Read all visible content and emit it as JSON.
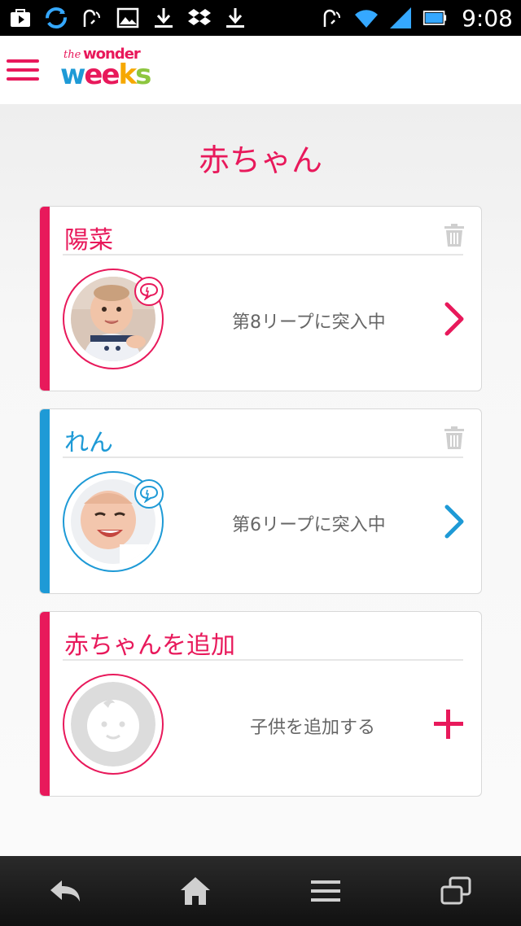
{
  "status_bar": {
    "time": "9:08",
    "icons": [
      "play-store-icon",
      "sync-icon",
      "nfc-icon",
      "image-icon",
      "download-icon",
      "dropbox-icon",
      "download-icon",
      "nfc-icon",
      "wifi-icon",
      "signal-icon",
      "battery-icon"
    ]
  },
  "app": {
    "logo_the": "the",
    "logo_wonder": "wonder",
    "logo_weeks": [
      "w",
      "ee",
      "k",
      "s"
    ]
  },
  "page": {
    "title": "赤ちゃん"
  },
  "babies": [
    {
      "name": "陽菜",
      "status": "第8リープに突入中",
      "accent": "#e8195b"
    },
    {
      "name": "れん",
      "status": "第6リープに突入中",
      "accent": "#1e9ad6"
    }
  ],
  "add_card": {
    "title": "赤ちゃんを追加",
    "label": "子供を追加する",
    "accent": "#e8195b"
  },
  "colors": {
    "brand_pink": "#e8195b",
    "brand_blue": "#1e9ad6",
    "trash_gray": "#cfcfcf"
  },
  "nav": [
    "back-icon",
    "home-icon",
    "menu-icon",
    "recent-apps-icon"
  ]
}
